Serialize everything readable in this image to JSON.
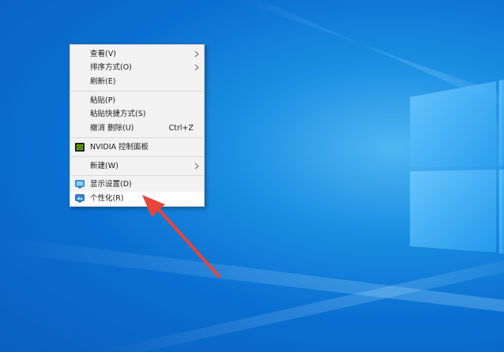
{
  "context_menu": {
    "items": [
      {
        "label": "查看(V)",
        "has_submenu": true
      },
      {
        "label": "排序方式(O)",
        "has_submenu": true
      },
      {
        "label": "刷新(E)"
      },
      {
        "label": "粘贴(P)"
      },
      {
        "label": "粘贴快捷方式(S)"
      },
      {
        "label": "撤消 删除(U)",
        "shortcut": "Ctrl+Z"
      },
      {
        "label": "NVIDIA 控制面板",
        "icon": "nvidia-icon"
      },
      {
        "label": "新建(W)",
        "has_submenu": true
      },
      {
        "label": "显示设置(D)",
        "icon": "display-settings-icon"
      },
      {
        "label": "个性化(R)",
        "icon": "personalize-icon",
        "highlighted": true
      }
    ]
  },
  "colors": {
    "desktop_blue": "#0a6fd0",
    "menu_bg": "#f2f2f2",
    "arrow_red": "#e8443a"
  }
}
